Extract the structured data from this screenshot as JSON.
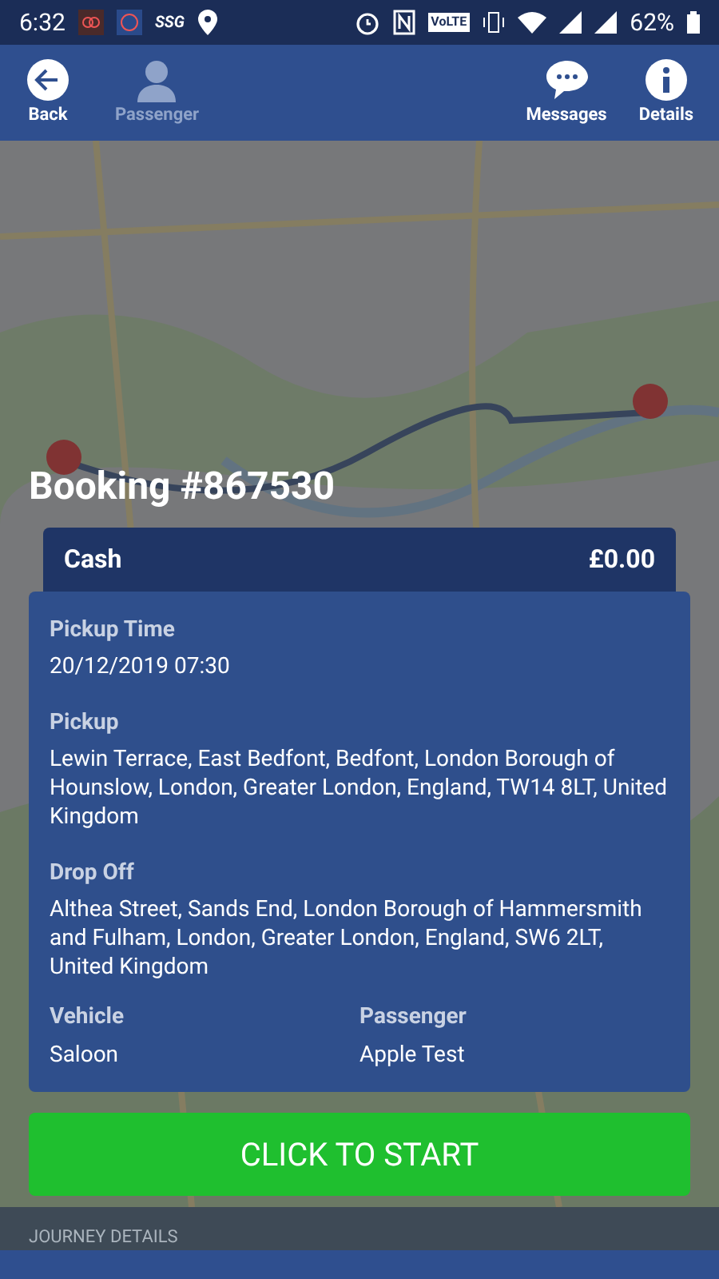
{
  "status_bar": {
    "time": "6:32",
    "logo_text": "SSG",
    "volte": "VoLTE",
    "battery": "62%"
  },
  "app_bar": {
    "actions": [
      {
        "label": "Back",
        "kind": "back",
        "disabled": false
      },
      {
        "label": "Passenger",
        "kind": "person",
        "disabled": true
      },
      {
        "label": "Messages",
        "kind": "chat",
        "disabled": false
      },
      {
        "label": "Details",
        "kind": "info",
        "disabled": false
      }
    ]
  },
  "booking": {
    "title": "Booking #867530",
    "payment": "Cash",
    "amount": "£0.00",
    "fields": [
      {
        "label": "Pickup Time",
        "value": "20/12/2019 07:30"
      },
      {
        "label": "Pickup",
        "value": "Lewin Terrace, East Bedfont, Bedfont, London Borough of Hounslow, London, Greater London, England, TW14 8LT, United Kingdom"
      },
      {
        "label": "Drop Off",
        "value": "Althea Street, Sands End, London Borough of Hammersmith and Fulham, London, Greater London, England, SW6 2LT, United Kingdom"
      }
    ],
    "pair": [
      {
        "label": "Vehicle",
        "value": "Saloon"
      },
      {
        "label": "Passenger",
        "value": "Apple Test"
      }
    ]
  },
  "start_button": "CLICK TO START",
  "journey_tab": "JOURNEY DETAILS"
}
